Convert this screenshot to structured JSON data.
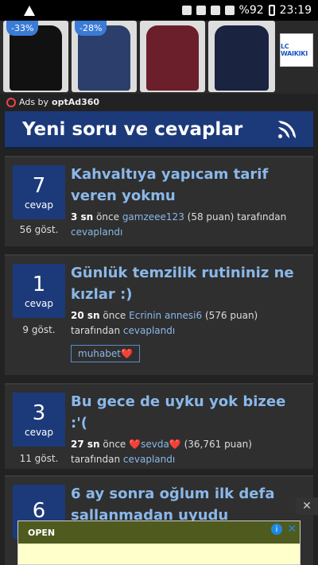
{
  "status_bar": {
    "battery": "%92",
    "time": "23:19"
  },
  "ads": {
    "discounts": [
      "-33%",
      "-28%"
    ],
    "brand": "LC WAIKIKI",
    "ads_by_prefix": "Ads by",
    "ads_by_name": "optAd360",
    "colors": {
      "discount_badge": "#3a7bd5"
    }
  },
  "header": {
    "title": "Yeni soru ve cevaplar",
    "icon": "rss-icon"
  },
  "questions": [
    {
      "count": "7",
      "count_unit": "cevap",
      "views": "56 göst.",
      "title": "Kahvaltıya yapıcam tarif veren yokmu",
      "time": "3 sn",
      "time_suffix": "önce",
      "user": "gamzeee123",
      "points": "(58 puan)",
      "by": "tarafından",
      "action": "cevaplandı"
    },
    {
      "count": "1",
      "count_unit": "cevap",
      "views": "9 göst.",
      "title": "Günlük temzilik rutininiz ne kızlar :)",
      "time": "20 sn",
      "time_suffix": "önce",
      "user": "Ecrinin annesi6",
      "points": "(576 puan)",
      "by": "tarafından",
      "action": "cevaplandı",
      "tag": "muhabet❤️"
    },
    {
      "count": "3",
      "count_unit": "cevap",
      "views": "11 göst.",
      "title": "Bu gece de uyku yok bizee :'(",
      "time": "27 sn",
      "time_suffix": "önce",
      "user": "❤️sevda❤️",
      "points": "(36,761 puan)",
      "by": "tarafından",
      "action": "cevaplandı"
    },
    {
      "count": "6",
      "count_unit": "",
      "title": "6 ay sonra oğlum ilk defa sallanmadan uyudu"
    }
  ],
  "bottom_ad": {
    "text": "OPEN",
    "close": "✕"
  },
  "float_close": "✕",
  "colors": {
    "brand_blue": "#1c3a7a",
    "link": "#8ab8ea",
    "bg": "#222222"
  }
}
